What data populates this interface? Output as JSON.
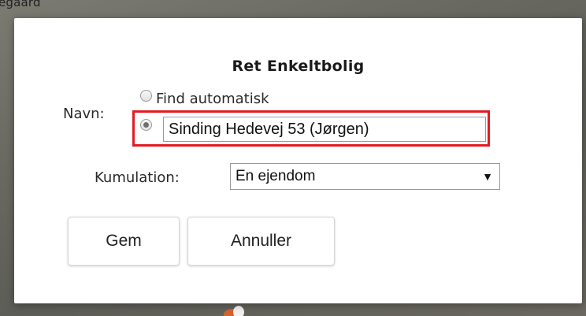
{
  "map": {
    "label": "egaard"
  },
  "dialog": {
    "title": "Ret Enkeltbolig",
    "navn_label": "Navn:",
    "radio_auto_label": "Find automatisk",
    "radio_auto_checked": false,
    "radio_name_checked": true,
    "name_input_value": "Sinding Hedevej 53 (Jørgen)",
    "kumulation_label": "Kumulation:",
    "kumulation_selected": "En ejendom",
    "save_button": "Gem",
    "cancel_button": "Annuller",
    "highlight_color": "#e21b23"
  }
}
